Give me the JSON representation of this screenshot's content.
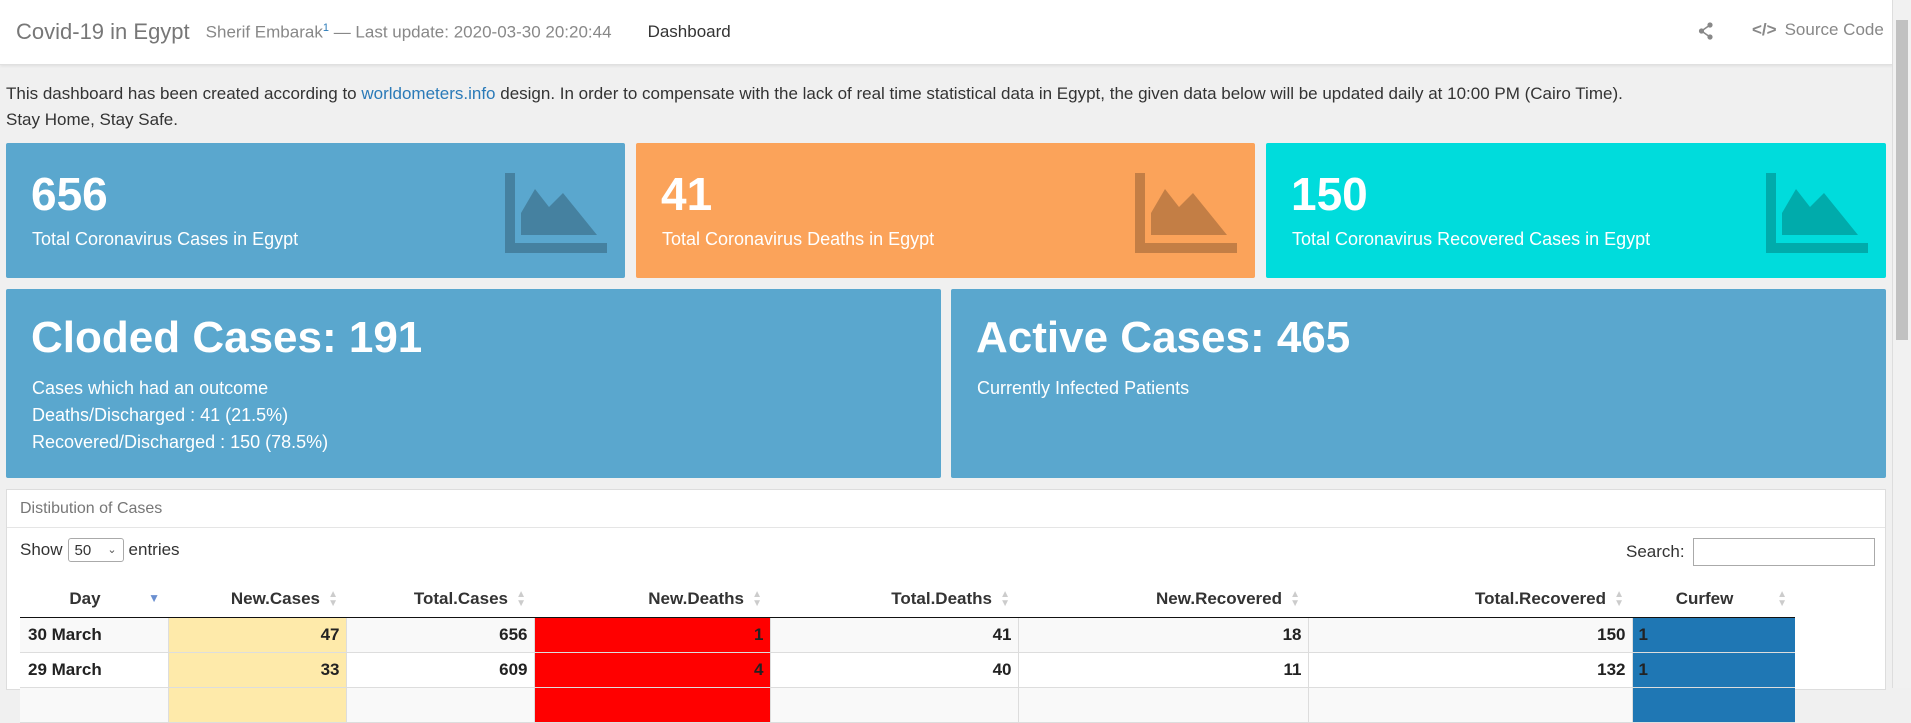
{
  "header": {
    "brand": "Covid-19 in Egypt",
    "author": "Sherif Embarak",
    "author_sup": "1",
    "last_update": "— Last update: 2020-03-30 20:20:44",
    "nav": "Dashboard",
    "source_code": "Source Code"
  },
  "intro": {
    "before_link": "This dashboard has been created according to ",
    "link": "worldometers.info",
    "after_link": " design. In order to compensate with the lack of real time statistical data in Egypt, the given data below will be updated daily at 10:00 PM (Cairo Time).",
    "line2": "Stay Home, Stay Safe."
  },
  "stats": {
    "cases": {
      "value": "656",
      "label": "Total Coronavirus Cases in Egypt",
      "color": "#5aa7ce"
    },
    "deaths": {
      "value": "41",
      "label": "Total Coronavirus Deaths in Egypt",
      "color": "#fba35a"
    },
    "recovered": {
      "value": "150",
      "label": "Total Coronavirus Recovered Cases in Egypt",
      "color": "#00dcdc"
    }
  },
  "closed": {
    "title": "Cloded Cases: 191",
    "line1": "Cases which had an outcome",
    "line2": "Deaths/Discharged : 41 (21.5%)",
    "line3": "Recovered/Discharged : 150 (78.5%)"
  },
  "active": {
    "title": "Active Cases: 465",
    "line1": "Currently Infected Patients"
  },
  "table": {
    "panel_title": "Distibution of Cases",
    "show": "Show",
    "entries_value": "50",
    "entries": "entries",
    "search_label": "Search:",
    "columns": [
      "Day",
      "New.Cases",
      "Total.Cases",
      "New.Deaths",
      "Total.Deaths",
      "New.Recovered",
      "Total.Recovered",
      "Curfew"
    ],
    "rows": [
      [
        "30 March",
        "47",
        "656",
        "1",
        "41",
        "18",
        "150",
        "1"
      ],
      [
        "29 March",
        "33",
        "609",
        "4",
        "40",
        "11",
        "132",
        "1"
      ]
    ]
  }
}
